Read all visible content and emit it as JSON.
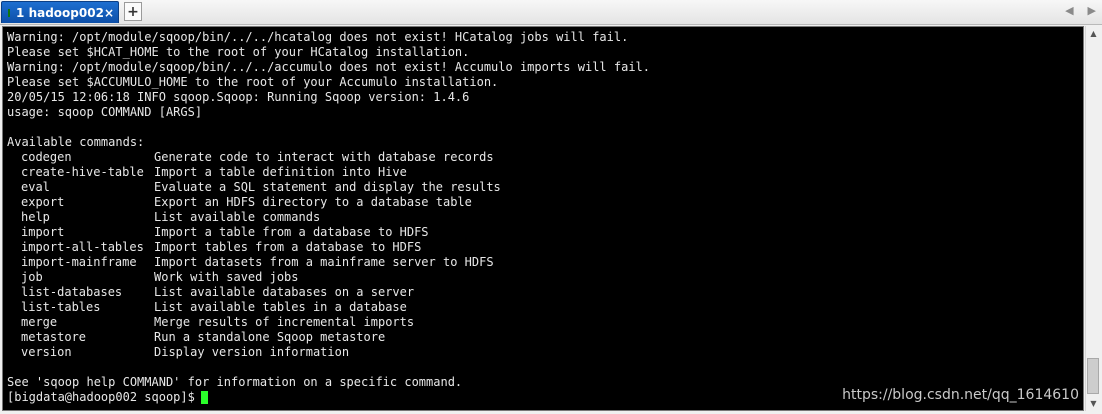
{
  "tabbar": {
    "tab_label": "1 hadoop002",
    "close_glyph": "×",
    "add_glyph": "+",
    "nav_left": "◀",
    "nav_right": "▶"
  },
  "terminal": {
    "header_lines": [
      "Warning: /opt/module/sqoop/bin/../../hcatalog does not exist! HCatalog jobs will fail.",
      "Please set $HCAT_HOME to the root of your HCatalog installation.",
      "Warning: /opt/module/sqoop/bin/../../accumulo does not exist! Accumulo imports will fail.",
      "Please set $ACCUMULO_HOME to the root of your Accumulo installation.",
      "20/05/15 12:06:18 INFO sqoop.Sqoop: Running Sqoop version: 1.4.6",
      "usage: sqoop COMMAND [ARGS]"
    ],
    "available_title": "Available commands:",
    "commands": [
      {
        "name": "codegen",
        "desc": "Generate code to interact with database records"
      },
      {
        "name": "create-hive-table",
        "desc": "Import a table definition into Hive"
      },
      {
        "name": "eval",
        "desc": "Evaluate a SQL statement and display the results"
      },
      {
        "name": "export",
        "desc": "Export an HDFS directory to a database table"
      },
      {
        "name": "help",
        "desc": "List available commands"
      },
      {
        "name": "import",
        "desc": "Import a table from a database to HDFS"
      },
      {
        "name": "import-all-tables",
        "desc": "Import tables from a database to HDFS"
      },
      {
        "name": "import-mainframe",
        "desc": "Import datasets from a mainframe server to HDFS"
      },
      {
        "name": "job",
        "desc": "Work with saved jobs"
      },
      {
        "name": "list-databases",
        "desc": "List available databases on a server"
      },
      {
        "name": "list-tables",
        "desc": "List available tables in a database"
      },
      {
        "name": "merge",
        "desc": "Merge results of incremental imports"
      },
      {
        "name": "metastore",
        "desc": "Run a standalone Sqoop metastore"
      },
      {
        "name": "version",
        "desc": "Display version information"
      }
    ],
    "footer_line": "See 'sqoop help COMMAND' for information on a specific command.",
    "prompt": "[bigdata@hadoop002 sqoop]$",
    "cursor_color": "#2aff2a"
  },
  "watermark": "https://blog.csdn.net/qq_1614610",
  "scrollbar": {
    "up_glyph": "▲",
    "down_glyph": "▼"
  }
}
